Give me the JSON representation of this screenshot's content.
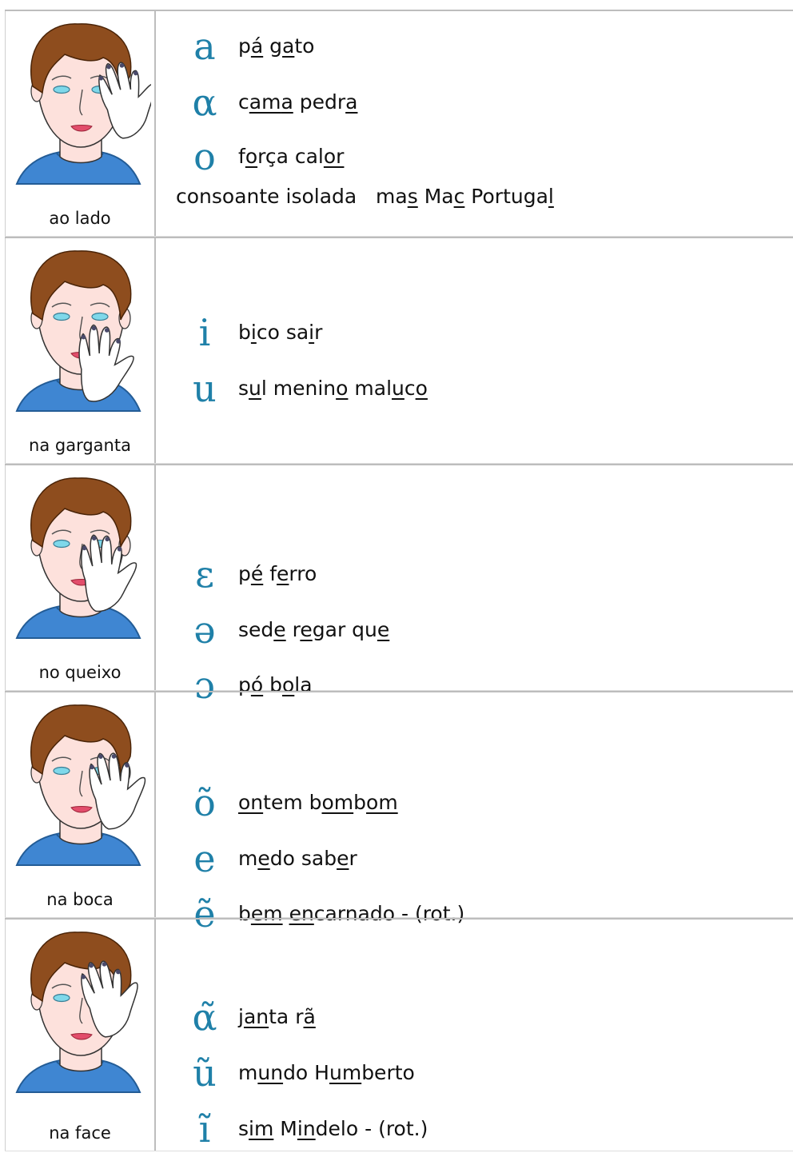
{
  "rows": [
    {
      "caption": "ao lado",
      "entries": [
        {
          "symbol": "a",
          "words": [
            {
              "t": "p"
            },
            {
              "t": "á",
              "u": true
            },
            {
              "t": " g"
            },
            {
              "t": "a",
              "u": true
            },
            {
              "t": "to"
            }
          ]
        },
        {
          "symbol": "α",
          "words": [
            {
              "t": "c"
            },
            {
              "t": "am",
              "u": true
            },
            {
              "t": "a",
              "u": true
            },
            {
              "t": " pedr"
            },
            {
              "t": "a",
              "u": true
            }
          ]
        },
        {
          "symbol": "o",
          "words": [
            {
              "t": "f"
            },
            {
              "t": "o",
              "u": true
            },
            {
              "t": "rça cal"
            },
            {
              "t": "or",
              "u": true
            }
          ]
        }
      ],
      "extra": [
        {
          "t": "consoante isolada   ma"
        },
        {
          "t": "s",
          "u": true
        },
        {
          "t": " Ma"
        },
        {
          "t": "c",
          "u": true
        },
        {
          "t": " Portuga"
        },
        {
          "t": "l",
          "u": true
        }
      ]
    },
    {
      "caption": "na garganta",
      "entries": [
        {
          "symbol": "i",
          "words": [
            {
              "t": "b"
            },
            {
              "t": "i",
              "u": true
            },
            {
              "t": "co sa"
            },
            {
              "t": "i",
              "u": true
            },
            {
              "t": "r"
            }
          ]
        },
        {
          "symbol": "u",
          "words": [
            {
              "t": "s"
            },
            {
              "t": "u",
              "u": true
            },
            {
              "t": "l menin"
            },
            {
              "t": "o",
              "u": true
            },
            {
              "t": " mal"
            },
            {
              "t": "u",
              "u": true
            },
            {
              "t": "c"
            },
            {
              "t": "o",
              "u": true
            }
          ]
        }
      ]
    },
    {
      "caption": "no queixo",
      "entries": [
        {
          "symbol": "ɛ",
          "words": [
            {
              "t": "p"
            },
            {
              "t": "é",
              "u": true
            },
            {
              "t": " f"
            },
            {
              "t": "e",
              "u": true
            },
            {
              "t": "rro"
            }
          ]
        },
        {
          "symbol": "ə",
          "words": [
            {
              "t": "sed"
            },
            {
              "t": "e",
              "u": true
            },
            {
              "t": " r"
            },
            {
              "t": "e",
              "u": true
            },
            {
              "t": "gar qu"
            },
            {
              "t": "e",
              "u": true
            }
          ]
        },
        {
          "symbol": "ɔ",
          "words": [
            {
              "t": "p"
            },
            {
              "t": "ó",
              "u": true
            },
            {
              "t": " b"
            },
            {
              "t": "o",
              "u": true
            },
            {
              "t": "la"
            }
          ]
        }
      ]
    },
    {
      "caption": "na boca",
      "entries": [
        {
          "symbol": "õ",
          "words": [
            {
              "t": "on",
              "u": true
            },
            {
              "t": "tem b"
            },
            {
              "t": "om",
              "u": true
            },
            {
              "t": "b"
            },
            {
              "t": "om",
              "u": true
            }
          ]
        },
        {
          "symbol": "e",
          "words": [
            {
              "t": "m"
            },
            {
              "t": "e",
              "u": true
            },
            {
              "t": "do sab"
            },
            {
              "t": "e",
              "u": true
            },
            {
              "t": "r"
            }
          ]
        },
        {
          "symbol": "ẽ",
          "words": [
            {
              "t": "b"
            },
            {
              "t": "em",
              "u": true
            },
            {
              "t": " "
            },
            {
              "t": "en",
              "u": true
            },
            {
              "t": "carnado - (rot.)"
            }
          ]
        }
      ]
    },
    {
      "caption": "na face",
      "entries": [
        {
          "symbol": "α̃",
          "words": [
            {
              "t": "j"
            },
            {
              "t": "an",
              "u": true
            },
            {
              "t": "ta r"
            },
            {
              "t": "ã",
              "u": true
            }
          ]
        },
        {
          "symbol": "ũ",
          "words": [
            {
              "t": "m"
            },
            {
              "t": "un",
              "u": true
            },
            {
              "t": "do H"
            },
            {
              "t": "um",
              "u": true
            },
            {
              "t": "berto"
            }
          ]
        },
        {
          "symbol": "ĩ",
          "words": [
            {
              "t": "s"
            },
            {
              "t": "im",
              "u": true
            },
            {
              "t": " M"
            },
            {
              "t": "in",
              "u": true
            },
            {
              "t": "delo - (rot.)"
            }
          ]
        }
      ]
    }
  ],
  "colors": {
    "symbol": "#1f80a8",
    "skin": "#fde1dc",
    "hair": "#8e4d1e",
    "shirt": "#3f86d2",
    "border": "#bdbdbd"
  }
}
